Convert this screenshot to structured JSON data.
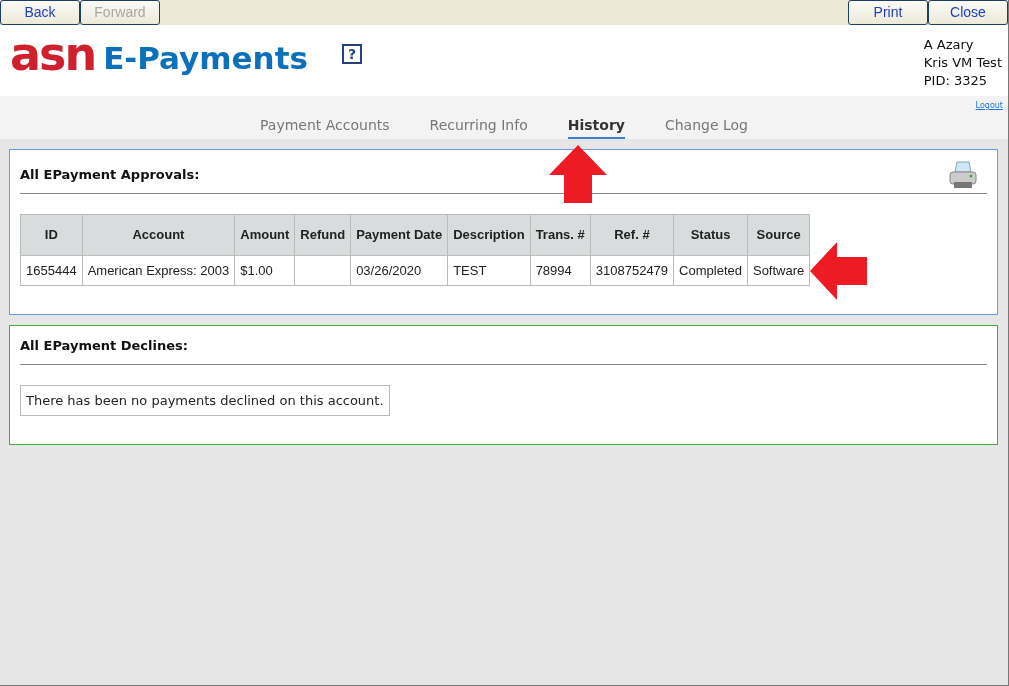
{
  "toolbar": {
    "left": [
      {
        "label": "Back",
        "disabled": false
      },
      {
        "label": "Forward",
        "disabled": true
      }
    ],
    "right": [
      {
        "label": "Print",
        "disabled": false
      },
      {
        "label": "Close",
        "disabled": false
      }
    ]
  },
  "logo": {
    "mark": "asn",
    "name": "E-Payments"
  },
  "help": "?",
  "user": {
    "lines": [
      "A Azary",
      "Kris VM Test",
      "PID: 3325"
    ],
    "logout": "Logout"
  },
  "tabs": [
    {
      "label": "Payment Accounts",
      "selected": false
    },
    {
      "label": "Recurring Info",
      "selected": false
    },
    {
      "label": "History",
      "selected": true
    },
    {
      "label": "Change Log",
      "selected": false
    }
  ],
  "approvals": {
    "title": "All EPayment Approvals:",
    "columns": [
      "ID",
      "Account",
      "Amount",
      "Refund",
      "Payment Date",
      "Description",
      "Trans. #",
      "Ref. #",
      "Status",
      "Source"
    ],
    "rows": [
      [
        "1655444",
        "American Express: 2003",
        "$1.00",
        "",
        "03/26/2020",
        "TEST",
        "78994",
        "3108752479",
        "Completed",
        "Software"
      ]
    ]
  },
  "declines": {
    "title": "All EPayment Declines:",
    "message": "There has been no payments declined on this account."
  }
}
